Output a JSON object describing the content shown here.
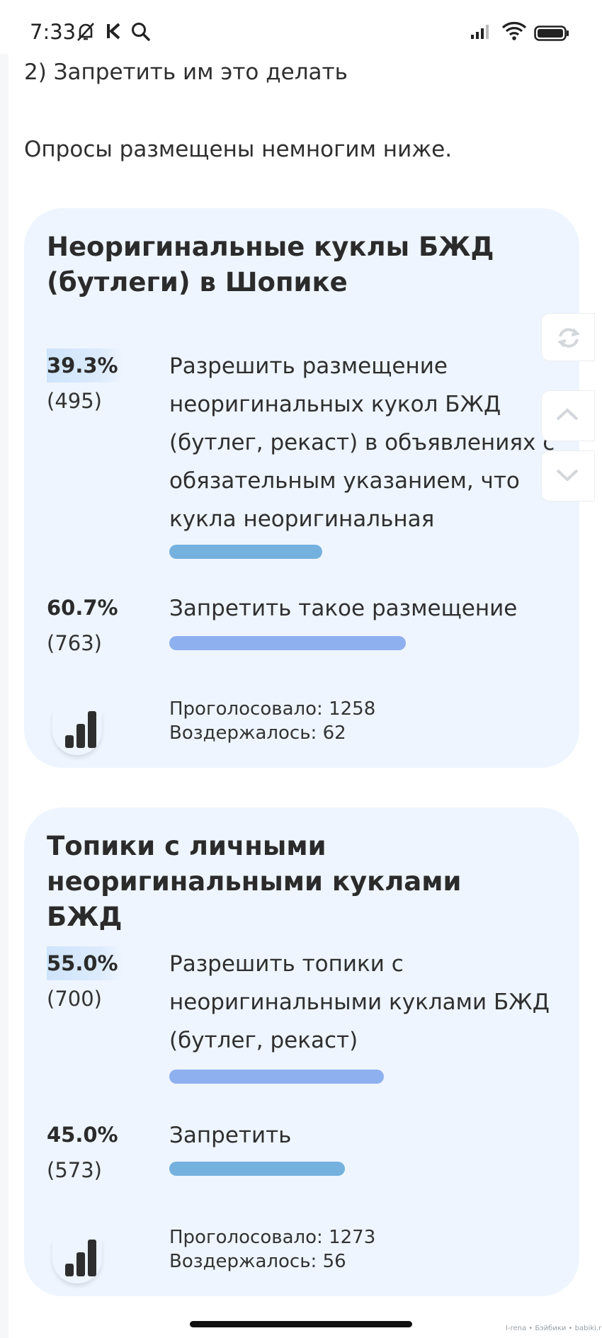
{
  "status_bar": {
    "time": "7:33",
    "icons": [
      "bell-off-icon",
      "kaspersky-icon",
      "search-icon",
      "signal-icon",
      "wifi-icon",
      "battery-icon"
    ]
  },
  "intro": {
    "line1": "2) Запретить им это делать",
    "line2": "Опросы размещены немногим ниже."
  },
  "polls": [
    {
      "title_line1": "Неоригинальные куклы БЖД",
      "title_line2": "(бутлеги) в Шопике",
      "options": [
        {
          "percent": "39.3%",
          "count": "(495)",
          "fraction": 0.393,
          "label_lines": [
            "Разрешить размещение",
            "неоригинальных кукол БЖД",
            "(бутлег, рекаст) в объявлениях с",
            "обязательным указанием, что",
            "кукла неоригинальная"
          ]
        },
        {
          "percent": "60.7%",
          "count": "(763)",
          "fraction": 0.607,
          "label_lines": [
            "Запретить такое размещение"
          ]
        }
      ],
      "voted": "Проголосовало: 1258",
      "abstained": "Воздержалось: 62"
    },
    {
      "title_line1": "Топики с личными",
      "title_line2": "неоригинальными куклами БЖД",
      "options": [
        {
          "percent": "55.0%",
          "count": "(700)",
          "fraction": 0.55,
          "label_lines": [
            "Разрешить топики с",
            "неоригинальными куклами БЖД",
            "(бутлег, рекаст)"
          ]
        },
        {
          "percent": "45.0%",
          "count": "(573)",
          "fraction": 0.45,
          "label_lines": [
            "Запретить"
          ]
        }
      ],
      "voted": "Проголосовало: 1273",
      "abstained": "Воздержалось: 56"
    }
  ],
  "watermark": "I-rena • Бэйбики • babiki.ru",
  "colors": {
    "card_bg": "#eef5ff",
    "bar_a": "#74b1de",
    "bar_b": "#8fb0ee"
  }
}
